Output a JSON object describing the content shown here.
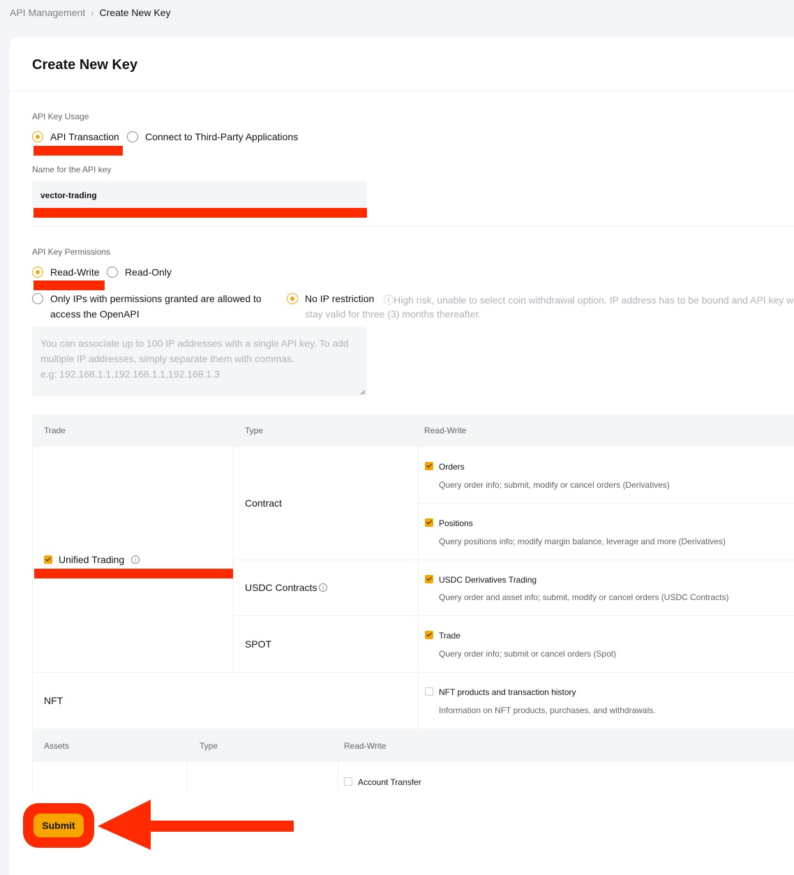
{
  "breadcrumb": {
    "parent": "API Management",
    "current": "Create New Key"
  },
  "page_title": "Create New Key",
  "usage": {
    "label": "API Key Usage",
    "options": [
      "API Transaction",
      "Connect to Third-Party Applications"
    ],
    "selected": "API Transaction"
  },
  "name_field": {
    "label": "Name for the API key",
    "value": "vector-trading"
  },
  "permissions": {
    "label": "API Key Permissions",
    "options": [
      "Read-Write",
      "Read-Only"
    ],
    "selected": "Read-Write"
  },
  "ip": {
    "option_restricted_line1": "Only IPs with permissions granted are allowed to",
    "option_restricted_line2": "access the OpenAPI",
    "option_none": "No IP restriction",
    "warning_line1": "ⓘHigh risk, unable to select coin withdrawal option. IP address has to be bound and API key w",
    "warning_line2": "stay valid for three (3) months thereafter.",
    "selected": "No IP restriction",
    "placeholder": "You can associate up to 100 IP addresses with a single API key. To add multiple IP addresses, simply separate them with commas.\ne.g: 192.168.1.1,192.168.1.1,192.168.1.3"
  },
  "trade_table": {
    "headers": {
      "trade": "Trade",
      "type": "Type",
      "rw": "Read-Write"
    },
    "unified_trading": {
      "label": "Unified Trading",
      "checked": true
    },
    "types": {
      "contract": "Contract",
      "usdc": "USDC Contracts",
      "spot": "SPOT"
    },
    "perms": {
      "orders": {
        "title": "Orders",
        "desc": "Query order info; submit, modify or cancel orders (Derivatives)",
        "checked": true
      },
      "positions": {
        "title": "Positions",
        "desc": "Query positions info; modify margin balance, leverage and more (Derivatives)",
        "checked": true
      },
      "usdc": {
        "title": "USDC Derivatives Trading",
        "desc": "Query order and asset info; submit, modify or cancel orders (USDC Contracts)",
        "checked": true
      },
      "trade": {
        "title": "Trade",
        "desc": "Query order info; submit or cancel orders (Spot)",
        "checked": true
      },
      "nft": {
        "title": "NFT products and transaction history",
        "desc": "Information on NFT products, purchases, and withdrawals.",
        "checked": false
      }
    },
    "nft_label": "NFT"
  },
  "assets_table": {
    "headers": {
      "assets": "Assets",
      "type": "Type",
      "rw": "Read-Write"
    },
    "account_transfer": {
      "title": "Account Transfer",
      "checked": false
    }
  },
  "submit_label": "Submit",
  "colors": {
    "accent": "#f7a600",
    "annotation": "#ff2a00"
  }
}
